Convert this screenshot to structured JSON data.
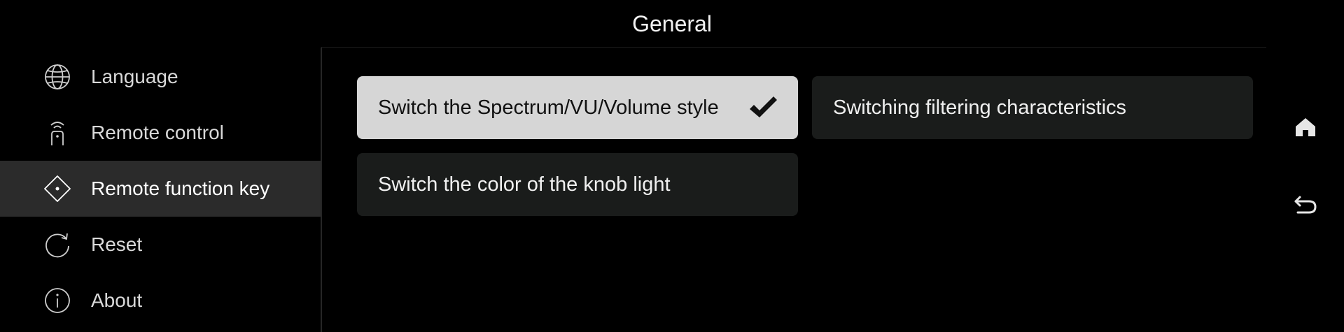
{
  "header": {
    "title": "General"
  },
  "sidebar": {
    "items": [
      {
        "label": "Language",
        "icon": "globe-icon"
      },
      {
        "label": "Remote control",
        "icon": "remote-control-icon"
      },
      {
        "label": "Remote function key",
        "icon": "remote-function-key-icon",
        "active": true
      },
      {
        "label": "Reset",
        "icon": "reset-icon"
      },
      {
        "label": "About",
        "icon": "info-icon"
      }
    ]
  },
  "main": {
    "options": [
      {
        "label": "Switch the Spectrum/VU/Volume style",
        "selected": true
      },
      {
        "label": "Switching filtering characteristics",
        "selected": false
      },
      {
        "label": "Switch the color of the knob light",
        "selected": false
      }
    ]
  },
  "rail": {
    "home_icon": "home-icon",
    "back_icon": "back-icon"
  },
  "colors": {
    "background": "#000000",
    "sidebar_active": "#2b2b2b",
    "option_bg": "#1a1c1b",
    "option_selected_bg": "#d6d6d6"
  }
}
